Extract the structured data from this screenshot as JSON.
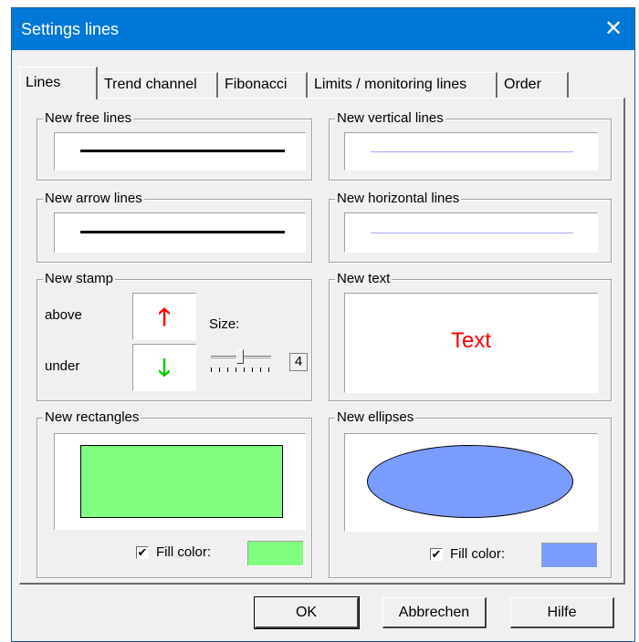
{
  "window": {
    "title": "Settings lines",
    "close_glyph": "✕"
  },
  "tabs": [
    {
      "label": "Lines",
      "active": true
    },
    {
      "label": "Trend channel",
      "active": false
    },
    {
      "label": "Fibonacci",
      "active": false
    },
    {
      "label": "Limits / monitoring lines",
      "active": false
    },
    {
      "label": "Order",
      "active": false
    }
  ],
  "groups": {
    "free_lines": "New free lines",
    "vertical_lines": "New vertical lines",
    "arrow_lines": "New arrow lines",
    "horizontal_lines": "New horizontal lines",
    "stamp": "New stamp",
    "text": "New text",
    "rectangles": "New rectangles",
    "ellipses": "New ellipses"
  },
  "stamp": {
    "above_label": "above",
    "under_label": "under",
    "size_label": "Size:",
    "size_value": "4",
    "above_icon": "red-up-arrow-icon",
    "under_icon": "green-down-arrow-icon"
  },
  "text_preview": {
    "value": "Text",
    "color": "#ff0000"
  },
  "rectangles": {
    "fill_label": "Fill color:",
    "fill_checked": true,
    "fill_color": "#80ff80",
    "check_glyph": "✔"
  },
  "ellipses": {
    "fill_label": "Fill color:",
    "fill_checked": true,
    "fill_color": "#7b9cff",
    "check_glyph": "✔"
  },
  "buttons": {
    "ok": "OK",
    "cancel": "Abbrechen",
    "help": "Hilfe"
  },
  "colors": {
    "titlebar": "#0078d7",
    "dialog_bg": "#f0f0f0",
    "line_blue": "#a8a8ff"
  }
}
